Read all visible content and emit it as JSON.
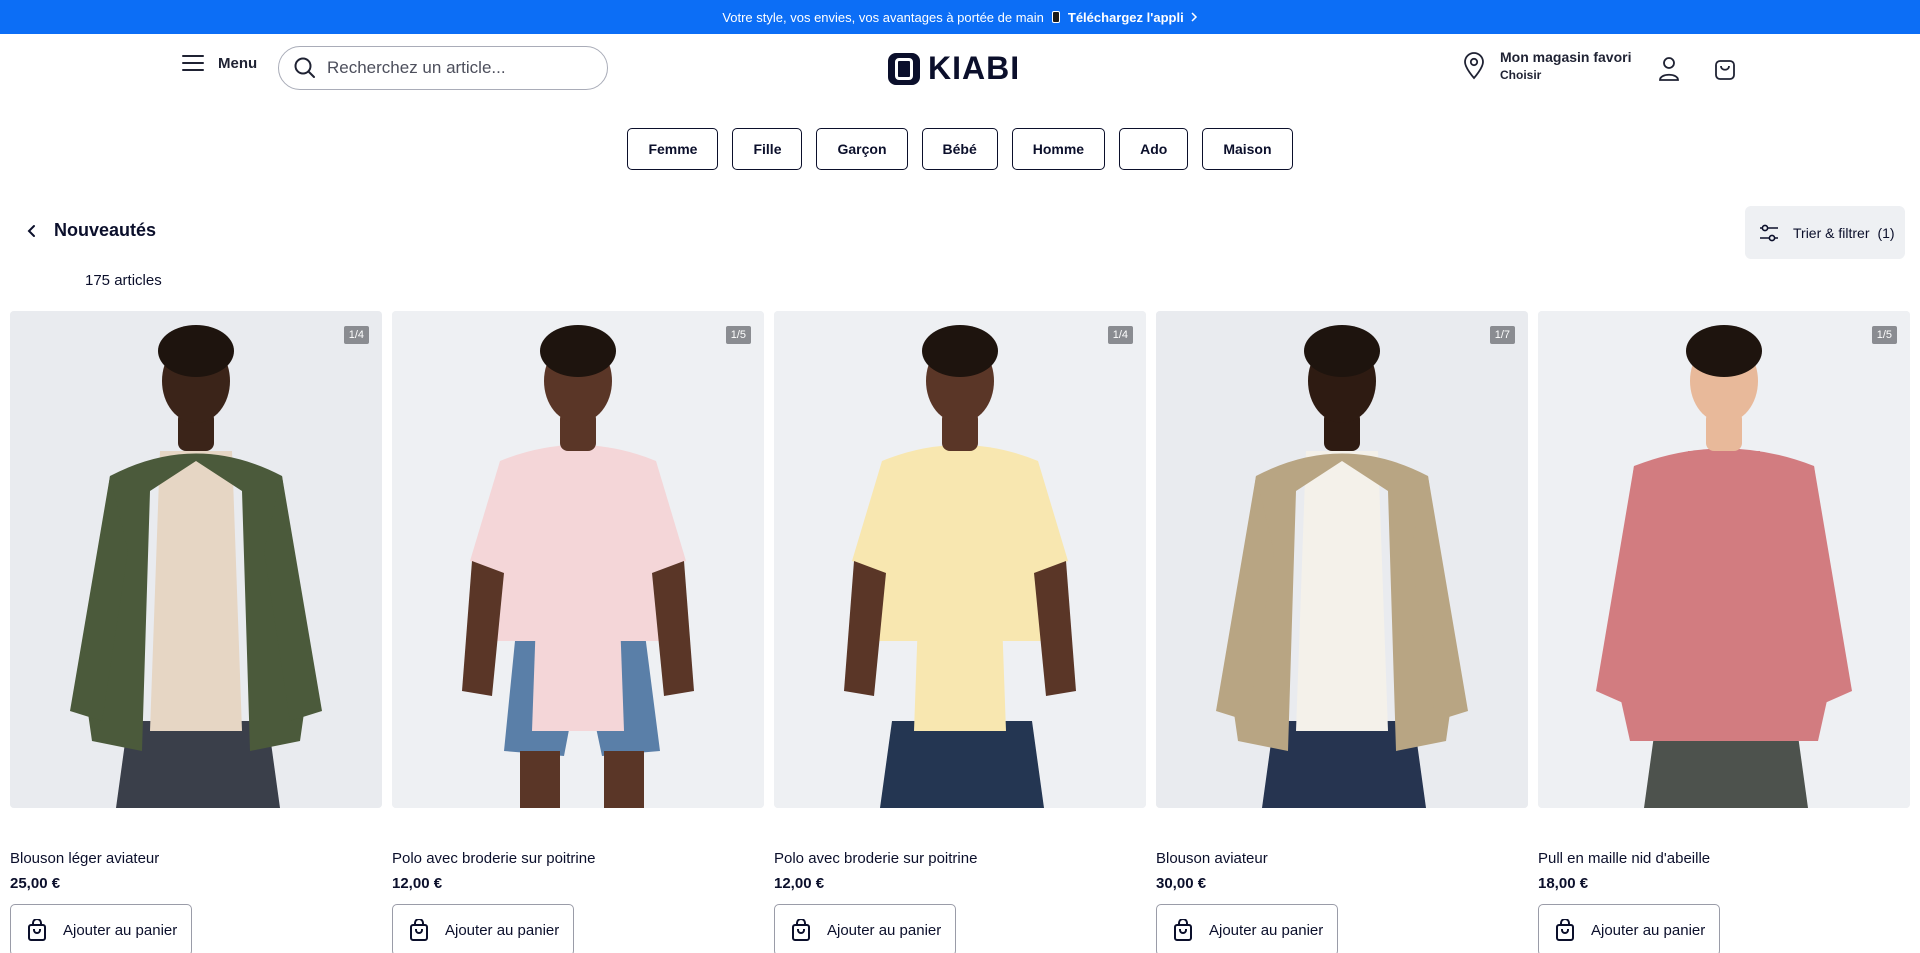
{
  "promo": {
    "text": "Votre style, vos envies, vos avantages à portée de main",
    "cta": "Téléchargez l'appli"
  },
  "header": {
    "menu_label": "Menu",
    "search_placeholder": "Recherchez un article...",
    "logo_text": "KIABI",
    "store_title": "Mon magasin favori",
    "store_sub": "Choisir"
  },
  "categories": [
    "Femme",
    "Fille",
    "Garçon",
    "Bébé",
    "Homme",
    "Ado",
    "Maison"
  ],
  "page": {
    "title": "Nouveautés",
    "count": "175 articles",
    "filter_label": "Trier & filtrer",
    "filter_count": "(1)"
  },
  "products": [
    {
      "name": "Blouson léger aviateur",
      "price": "25,00 €",
      "badge": "1/4",
      "add_label": "Ajouter au panier",
      "bg": "#e9ebef",
      "garment": "#4b5a3b",
      "under": "#e6d6c4",
      "pants": "#3a3f4a",
      "skin": "#3b2419",
      "style": "jacket"
    },
    {
      "name": "Polo avec broderie sur poitrine",
      "price": "12,00 €",
      "badge": "1/5",
      "add_label": "Ajouter au panier",
      "bg": "#eef0f3",
      "garment": "#f4d6d8",
      "under": "#f4d6d8",
      "pants": "#5a7fa8",
      "skin": "#5a3627",
      "style": "polo-shorts"
    },
    {
      "name": "Polo avec broderie sur poitrine",
      "price": "12,00 €",
      "badge": "1/4",
      "add_label": "Ajouter au panier",
      "bg": "#eef0f3",
      "garment": "#f8e7b0",
      "under": "#f8e7b0",
      "pants": "#243652",
      "skin": "#5a3627",
      "style": "polo"
    },
    {
      "name": "Blouson aviateur",
      "price": "30,00 €",
      "badge": "1/7",
      "add_label": "Ajouter au panier",
      "bg": "#e9ebef",
      "garment": "#b8a583",
      "under": "#f4f1ea",
      "pants": "#263450",
      "skin": "#2e1b12",
      "style": "jacket"
    },
    {
      "name": "Pull en maille nid d'abeille",
      "price": "18,00 €",
      "badge": "1/5",
      "add_label": "Ajouter au panier",
      "bg": "#eef0f3",
      "garment": "#d27c80",
      "under": "#d27c80",
      "pants": "#4d524d",
      "skin": "#e8b99a",
      "style": "sweater"
    }
  ]
}
